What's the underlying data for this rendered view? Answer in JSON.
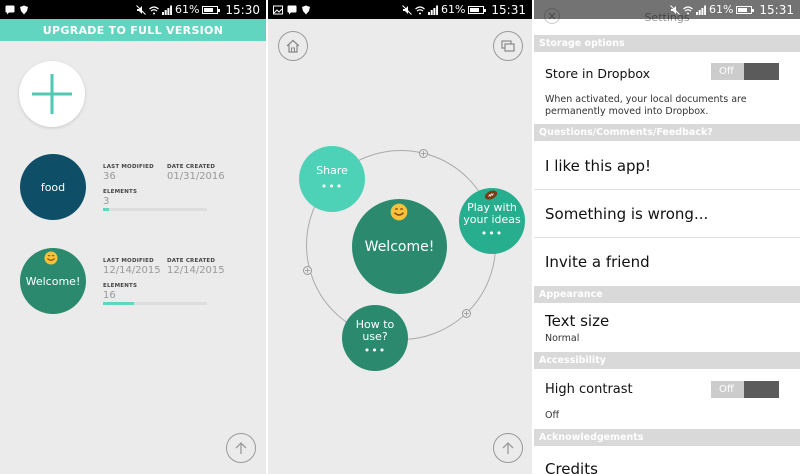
{
  "status_bars": [
    {
      "battery": "61%",
      "time": "15:30"
    },
    {
      "battery": "61%",
      "time": "15:31"
    },
    {
      "battery": "61%",
      "time": "15:31"
    }
  ],
  "documents_screen": {
    "upgrade_label": "UPGRADE TO FULL VERSION",
    "documents": [
      {
        "name": "food",
        "color": "#0e4f67",
        "last_modified_label": "LAST MODIFIED",
        "last_modified": "36",
        "date_created_label": "DATE CREATED",
        "date_created": "01/31/2016",
        "elements_label": "ELEMENTS",
        "elements": "3",
        "progress": 0.06
      },
      {
        "name": "Welcome!",
        "color": "#2b8a6e",
        "last_modified_label": "LAST MODIFIED",
        "last_modified": "12/14/2015",
        "date_created_label": "DATE CREATED",
        "date_created": "12/14/2015",
        "elements_label": "ELEMENTS",
        "elements": "16",
        "progress": 0.3
      }
    ]
  },
  "mindmap_screen": {
    "center": "Welcome!",
    "nodes": [
      {
        "label": "Share",
        "dots": "•••"
      },
      {
        "label": "Play with your ideas",
        "dots": "•••"
      },
      {
        "label": "How to use?",
        "dots": "•••"
      }
    ]
  },
  "settings_screen": {
    "title": "Settings",
    "storage_header": "Storage options",
    "store_dropbox": "Store in Dropbox",
    "store_dropbox_toggle": "Off",
    "store_dropbox_desc": "When activated, your local documents are permanently moved into Dropbox.",
    "feedback_header": "Questions/Comments/Feedback?",
    "like_app": "I like this app!",
    "something_wrong": "Something is wrong...",
    "invite_friend": "Invite a friend",
    "appearance_header": "Appearance",
    "text_size": "Text size",
    "text_size_value": "Normal",
    "accessibility_header": "Accessibility",
    "high_contrast": "High contrast",
    "high_contrast_toggle": "Off",
    "high_contrast_value": "Off",
    "acknowledgements_header": "Acknowledgements",
    "credits": "Credits"
  },
  "colors": {
    "accent": "#62d5c0",
    "teal_light": "#4dd2b7",
    "teal_mid": "#27ae8e",
    "green_dark": "#2b8a6e",
    "navy": "#0e4f67"
  }
}
